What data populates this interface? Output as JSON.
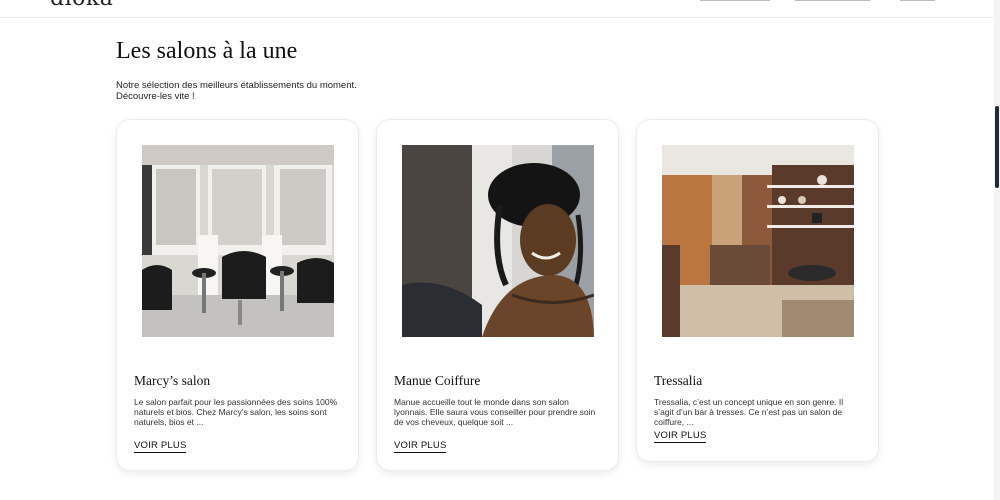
{
  "header": {
    "logo_text": "diokà"
  },
  "section": {
    "title": "Les salons à la une",
    "subtitle_line1": "Notre sélection des meilleurs établissements du moment.",
    "subtitle_line2": "Découvre-les vite !"
  },
  "salons": [
    {
      "name": "Marcy’s salon",
      "description": "Le salon parfait pour les passionnées des soins 100% naturels et bios. Chez Marcy’s salon, les soins sont naturels, bios et ...",
      "cta": "VOIR PLUS",
      "image": "salon-interior-photo"
    },
    {
      "name": "Manue Coiffure",
      "description": "Manue accueille tout le monde dans son salon lyonnais. Elle saura vous conseiller pour prendre soin de vos cheveux, quelque soit ...",
      "cta": "VOIR PLUS",
      "image": "hairstylist-portrait-photo"
    },
    {
      "name": "Tressalia",
      "description": "Tressalia, c’est un concept unique en son genre. Il s’agit d’un bar à tresses. Ce n’est pas un salon de coiffure, ...",
      "cta": "VOIR PLUS",
      "image": "braid-bar-interior-photo"
    }
  ],
  "colors": {
    "scrollbar_thumb": "#1f2a3a",
    "card_border": "#ececec",
    "text": "#111111"
  }
}
